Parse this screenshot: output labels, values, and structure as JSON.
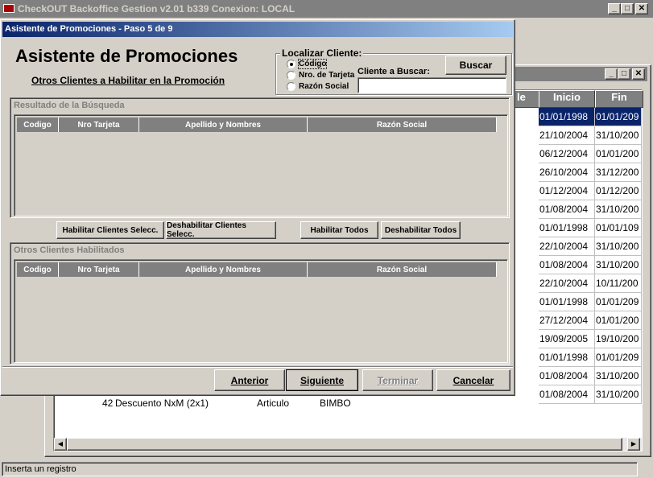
{
  "main_window": {
    "title": "CheckOUT Backoffice Gestion v2.01 b339 Conexion: LOCAL",
    "status": "Inserta un registro"
  },
  "bg_grid": {
    "columns": [
      "le",
      "Inicio",
      "Fin"
    ],
    "rows": [
      {
        "inicio": "01/01/1998",
        "fin": "01/01/209"
      },
      {
        "inicio": "21/10/2004",
        "fin": "31/10/200"
      },
      {
        "inicio": "06/12/2004",
        "fin": "01/01/200"
      },
      {
        "inicio": "26/10/2004",
        "fin": "31/12/200"
      },
      {
        "inicio": "01/12/2004",
        "fin": "01/12/200"
      },
      {
        "inicio": "01/08/2004",
        "fin": "31/10/200"
      },
      {
        "inicio": "01/01/1998",
        "fin": "01/01/109"
      },
      {
        "inicio": "22/10/2004",
        "fin": "31/10/200"
      },
      {
        "inicio": "01/08/2004",
        "fin": "31/10/200"
      },
      {
        "inicio": "22/10/2004",
        "fin": "10/11/200"
      },
      {
        "inicio": "01/01/1998",
        "fin": "01/01/209"
      },
      {
        "inicio": "27/12/2004",
        "fin": "01/01/200"
      },
      {
        "inicio": "19/09/2005",
        "fin": "19/10/200"
      },
      {
        "inicio": "01/01/1998",
        "fin": "01/01/209"
      },
      {
        "inicio": "01/08/2004",
        "fin": "31/10/200"
      },
      {
        "inicio": "01/08/2004",
        "fin": "31/10/200"
      }
    ],
    "partial_row": {
      "id": "42",
      "desc": "Descuento NxM (2x1)",
      "type": "Articulo",
      "brand": "BIMBO"
    }
  },
  "dialog": {
    "title": "Asistente de Promociones - Paso 5 de 9",
    "heading": "Asistente de Promociones",
    "subheading": "Otros Clientes a Habilitar en la Promoción",
    "locate": {
      "group_label": "Localizar Cliente:",
      "options": [
        "Código",
        "Nro. de Tarjeta",
        "Razón Social"
      ],
      "selected": "Código",
      "search_label": "Cliente a Buscar:",
      "search_value": "",
      "search_button": "Buscar"
    },
    "results": {
      "title": "Resultado de la Búsqueda",
      "columns": [
        "Codigo",
        "Nro Tarjeta",
        "Apellido y Nombres",
        "Razón Social"
      ]
    },
    "actions": {
      "enable_selected": "Habilitar Clientes Selecc.",
      "disable_selected": "Deshabilitar Clientes Selecc.",
      "enable_all": "Habilitar Todos",
      "disable_all": "Deshabilitar Todos"
    },
    "enabled": {
      "title": "Otros Clientes Habilitados",
      "columns": [
        "Codigo",
        "Nro Tarjeta",
        "Apellido y Nombres",
        "Razón Social"
      ]
    },
    "footer": {
      "back": "Anterior",
      "next": "Siguiente",
      "finish": "Terminar",
      "cancel": "Cancelar"
    }
  }
}
